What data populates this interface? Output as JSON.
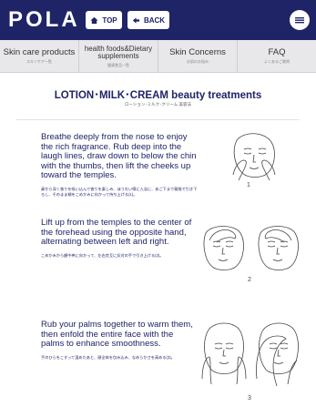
{
  "header": {
    "logo": "POLA",
    "top_label": "TOP",
    "back_label": "BACK"
  },
  "nav": [
    {
      "en": "Skin care products",
      "jp": "スキンケア一覧"
    },
    {
      "en": "health foods&Dietary supplements",
      "jp": "健康食品一覧"
    },
    {
      "en": "Skin Concerns",
      "jp": "お肌のお悩み"
    },
    {
      "en": "FAQ",
      "jp": "よくあるご質問"
    }
  ],
  "page": {
    "title": "LOTION･MILK･CREAM beauty treatments",
    "subtitle": "ローション･ミルク･クリーム 美容法"
  },
  "steps": [
    {
      "en": "Breathe deeply from the nose to enjoy the rich fragrance. Rub deep into the laugh lines, draw down to below the chin with the thumbs, then lift the cheeks up toward the temples.",
      "jp": "鼻から深く香りを吸い込んで香りを楽しみ、ほうれい線に入念に、あご下まで親指で引き下ろし、そのまま頬をこめかみに向かって持ち上げる(1)。",
      "number": "1"
    },
    {
      "en": "Lift up from the temples to the center of the forehead using the opposite hand, alternating between left and right.",
      "jp": "こめかみから額中央に向かって、左右交互に反対の手で引き上げる(2)。",
      "number": "2"
    },
    {
      "en": "Rub your palms together to warm them, then enfold the entire face with the palms to enhance smoothness.",
      "jp": "手のひらをこすって温めたあと、顔全体を包み込み、なめらかさを高める(3)。",
      "number": "3"
    }
  ],
  "colors": {
    "brand": "#1f2466",
    "nav_bg": "#e8e8ea"
  },
  "icons": [
    "home-icon",
    "back-arrow-icon",
    "menu-icon"
  ]
}
